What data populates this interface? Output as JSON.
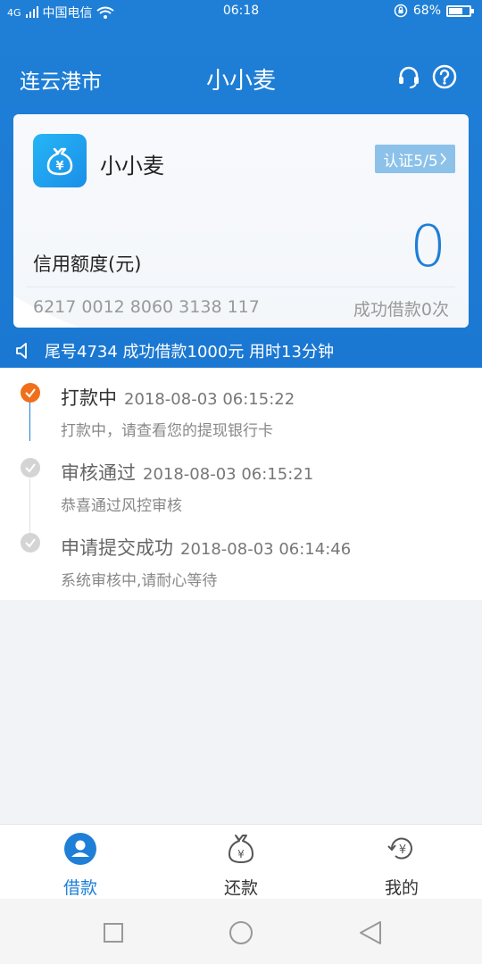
{
  "status_bar": {
    "signal": "4G",
    "carrier": "中国电信",
    "time": "06:18",
    "battery": "68%",
    "battery_level": 0.68
  },
  "header": {
    "city": "连云港市",
    "title": "小小麦"
  },
  "card": {
    "app_name": "小小麦",
    "cert_badge": "认证5/5",
    "credit_label": "信用额度(元)",
    "credit_value": "0",
    "card_number": "6217 0012 8060 3138 117",
    "loan_count": "成功借款0次"
  },
  "notice": "尾号4734 成功借款1000元 用时13分钟",
  "timeline": [
    {
      "title": "打款中",
      "time": "2018-08-03 06:15:22",
      "desc": "打款中，请查看您的提现银行卡",
      "active": true
    },
    {
      "title": "审核通过",
      "time": "2018-08-03 06:15:21",
      "desc": "恭喜通过风控审核",
      "active": false
    },
    {
      "title": "申请提交成功",
      "time": "2018-08-03 06:14:46",
      "desc": "系统审核中,请耐心等待",
      "active": false
    }
  ],
  "bottom_nav": [
    {
      "label": "借款",
      "icon": "user-icon",
      "active": true
    },
    {
      "label": "还款",
      "icon": "money-bag-icon",
      "active": false
    },
    {
      "label": "我的",
      "icon": "refresh-yuan-icon",
      "active": false
    }
  ],
  "colors": {
    "brand": "#1f7fd7",
    "active_step": "#f06f1a",
    "inactive_step": "#d4d4d4",
    "badge": "#8cc1ea"
  }
}
